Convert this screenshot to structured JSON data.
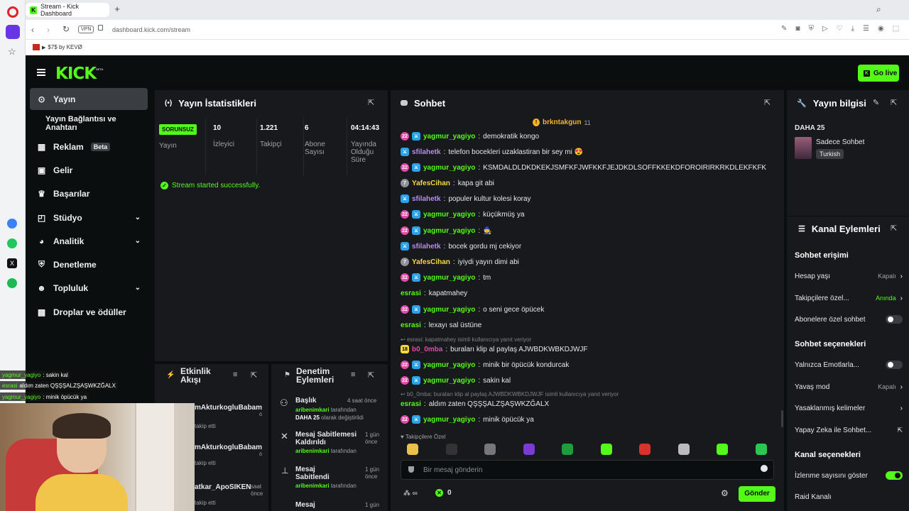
{
  "browser": {
    "tab_title": "Stream - Kick Dashboard",
    "address": "dashboard.kick.com/stream",
    "vpn": "VPN",
    "bookmark": "$7$ by KEVØ"
  },
  "header": {
    "logo": "KICK",
    "logo_sup": "BETA",
    "go_live": "Go live"
  },
  "sidebar": {
    "items": [
      {
        "label": "Yayın"
      },
      {
        "label": "Yayın Bağlantısı ve Anahtarı"
      },
      {
        "label": "Reklam",
        "badge": "Beta"
      },
      {
        "label": "Gelir"
      },
      {
        "label": "Başarılar"
      },
      {
        "label": "Stüdyo"
      },
      {
        "label": "Analitik"
      },
      {
        "label": "Denetleme"
      },
      {
        "label": "Topluluk"
      },
      {
        "label": "Droplar ve ödüller"
      }
    ]
  },
  "stats": {
    "title": "Yayın İstatistikleri",
    "status": "SORUNSUZ",
    "status_label": "Yayın",
    "viewers": "10",
    "viewers_label": "İzleyici",
    "followers": "1.221",
    "followers_label": "Takipçi",
    "subs": "6",
    "subs_label": "Abone Sayısı",
    "uptime": "04:14:43",
    "uptime_label": "Yayında Olduğu Süre",
    "notice": "Stream started successfully."
  },
  "activity": {
    "title": "Etkinlik Akışı",
    "items": [
      {
        "name": "mAkturkogluBabam",
        "sub": "takip etti",
        "extra": "ö"
      },
      {
        "name": "mAkturkogluBabam",
        "sub": "takip etti",
        "extra": "ö"
      },
      {
        "name": "atkar_ApoSIKEN",
        "sub": "takip etti",
        "time": "saat",
        "time2": "önce"
      }
    ]
  },
  "mod_actions": {
    "title": "Denetim Eylemleri",
    "items": [
      {
        "title": "Başlık",
        "time": "4 saat önce",
        "by": "aribenimkari",
        "by_suffix": "tarafından",
        "detail": "DAHA 25",
        "detail_suffix": "olarak değiştirildi"
      },
      {
        "title": "Mesaj Sabitlemesi Kaldırıldı",
        "time": "1 gün önce",
        "by": "aribenimkari",
        "by_suffix": "tarafından"
      },
      {
        "title": "Mesaj Sabitlendi",
        "time": "1 gün önce",
        "by": "aribenimkari",
        "by_suffix": "tarafından"
      },
      {
        "title": "Mesaj",
        "time": "1 gün"
      }
    ]
  },
  "chat": {
    "title": "Sohbet",
    "pinned_user": "brkntakgun",
    "pinned_count": "11",
    "messages": [
      {
        "user": "yagmur_yagiyo",
        "color": "#53fc18",
        "badges": [
          "sub",
          "mod"
        ],
        "text": "demokratik kongo"
      },
      {
        "user": "sfilahetk",
        "color": "#b68cf5",
        "badges": [
          "mod"
        ],
        "text": "telefon bocekleri uzaklastiran bir sey mi 😍"
      },
      {
        "user": "yagmur_yagiyo",
        "color": "#53fc18",
        "badges": [
          "sub",
          "mod"
        ],
        "text": "KSMDALDLDKDKEKJSMFKFJWFKKFJEJDKDLSOFFKKEKDFOROIRIRKRKDLEKFKFK"
      },
      {
        "user": "YafesCihan",
        "color": "#f5d940",
        "badges": [
          "v"
        ],
        "text": "kapa git abi"
      },
      {
        "user": "sfilahetk",
        "color": "#b68cf5",
        "badges": [
          "mod"
        ],
        "text": "populer kultur kolesi koray"
      },
      {
        "user": "yagmur_yagiyo",
        "color": "#53fc18",
        "badges": [
          "sub",
          "mod"
        ],
        "text": "küçükmüş ya"
      },
      {
        "user": "yagmur_yagiyo",
        "color": "#53fc18",
        "badges": [
          "sub",
          "mod"
        ],
        "text": "🧙"
      },
      {
        "user": "sfilahetk",
        "color": "#b68cf5",
        "badges": [
          "mod"
        ],
        "text": "bocek gordu mj cekiyor"
      },
      {
        "user": "YafesCihan",
        "color": "#f5d940",
        "badges": [
          "v"
        ],
        "text": "iyiydi yayın dimi abi"
      },
      {
        "user": "yagmur_yagiyo",
        "color": "#53fc18",
        "badges": [
          "sub",
          "mod"
        ],
        "text": "tm"
      },
      {
        "user": "esrasi",
        "color": "#53fc18",
        "badges": [],
        "text": "kapatmahey"
      },
      {
        "user": "yagmur_yagiyo",
        "color": "#53fc18",
        "badges": [
          "sub",
          "mod"
        ],
        "text": "o seni gece öpücek"
      },
      {
        "user": "esrasi",
        "color": "#53fc18",
        "badges": [],
        "text": "lexayı sal üstüne"
      }
    ],
    "reply1": "esrasi: kapatmahey isimli kullanıcıya yanıt veriyor",
    "msg_b0": {
      "user": "b0_0mba",
      "badge": "18",
      "text": "buraları klip al paylaş AJWBDKWBKDJWJF"
    },
    "msg_y2": {
      "user": "yagmur_yagiyo",
      "text": "minik bir öpücük kondurcak"
    },
    "msg_y3": {
      "user": "yagmur_yagiyo",
      "text": "sakin kal"
    },
    "reply2": "b0_0mba: buraları klip al paylaş AJWBDKWBKDJWJF isimli kullanıcıya yanıt veriyor",
    "msg_e3": {
      "user": "esrasi",
      "text": "aldım zaten QŞŞŞALZŞAŞWKZĞALX"
    },
    "msg_y4": {
      "user": "yagmur_yagiyo",
      "text": "minik öpücük ya"
    },
    "followers_only": "Takipçilere Özel",
    "placeholder": "Bir mesaj gönderin",
    "points": "0",
    "send": "Gönder"
  },
  "stream_info": {
    "title": "Yayın bilgisi",
    "stream_title": "DAHA 25",
    "category": "Sadece Sohbet",
    "language": "Turkish"
  },
  "channel_actions": {
    "title": "Kanal Eylemleri",
    "chat_access": "Sohbet erişimi",
    "account_age": "Hesap yaşı",
    "account_age_val": "Kapalı",
    "followers_only": "Takipçilere özel...",
    "followers_only_val": "Anında",
    "subs_only": "Abonelere özel sohbet",
    "chat_options": "Sohbet seçenekleri",
    "emotes_only": "Yalnızca Emotlarla...",
    "slow_mode": "Yavaş mod",
    "slow_mode_val": "Kapalı",
    "banned_words": "Yasaklanmış kelimeler",
    "ai_chat": "Yapay Zeka ile Sohbet...",
    "channel_options": "Kanal seçenekleri",
    "show_viewers": "İzlenme sayısını göster",
    "raid": "Raid Kanalı"
  },
  "overlay": {
    "lines": [
      {
        "user": "yagmur_yagiyo",
        "text": ": sakin kal"
      },
      {
        "user": "esrasi",
        "text": "aldım zaten QŞŞŞALZŞAŞWKZĞALX"
      },
      {
        "user": "yagmur_yagiyo",
        "text": ": minik öpücük ya"
      }
    ]
  },
  "colors": {
    "accent": "#53fc18",
    "panel": "#17191c",
    "bg": "#0b0e0f"
  }
}
